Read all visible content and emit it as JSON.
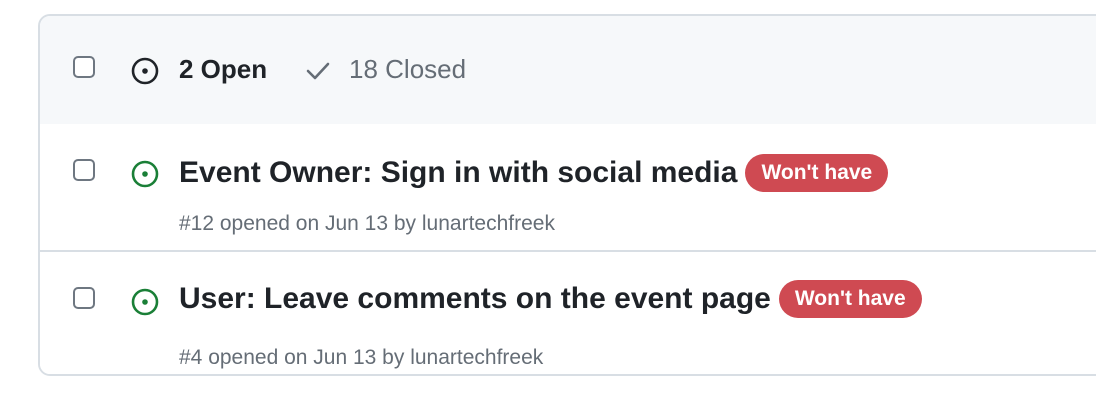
{
  "header": {
    "open_label": "2 Open",
    "closed_label": "18 Closed"
  },
  "issues": [
    {
      "title": "Event Owner: Sign in with social media",
      "label": "Won't have",
      "meta": "#12 opened on Jun 13 by lunartechfreek"
    },
    {
      "title": "User: Leave comments on the event page",
      "label": "Won't have",
      "meta": "#4 opened on Jun 13 by lunartechfreek"
    }
  ],
  "colors": {
    "open_icon": "#1a7f37",
    "label_bg": "#cf4a52",
    "muted_text": "#656d76",
    "border": "#d8dee4",
    "header_bg": "#f6f8fa"
  },
  "icons": {
    "open_filter": "issue-opened-icon",
    "closed_filter": "check-icon",
    "issue_state": "issue-opened-icon"
  }
}
